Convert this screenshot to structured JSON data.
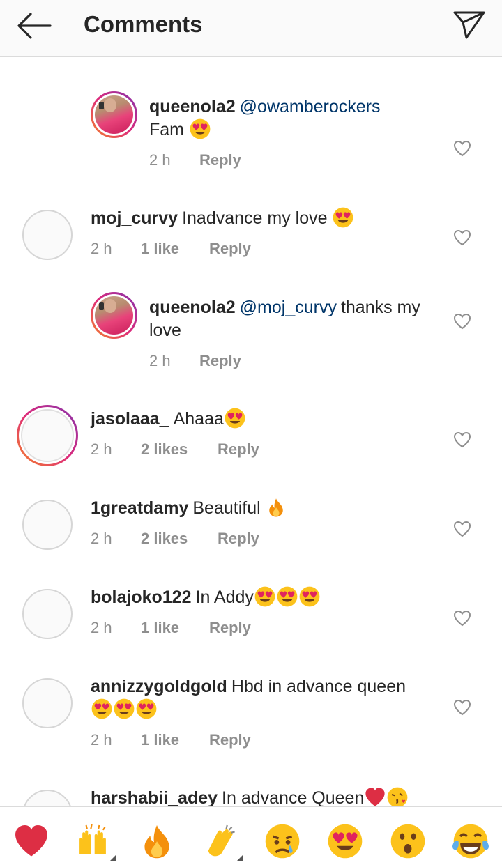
{
  "header": {
    "title": "Comments"
  },
  "comments": [
    {
      "username": "queenola2",
      "mention": "@owamberockers",
      "text": "Fam",
      "emojis": 1,
      "time": "2 h",
      "likes": "",
      "reply": "Reply",
      "is_reply": true
    },
    {
      "username": "moj_curvy",
      "mention": "",
      "text": "Inadvance my love",
      "emojis": 1,
      "time": "2 h",
      "likes": "1 like",
      "reply": "Reply",
      "is_reply": false
    },
    {
      "username": "queenola2",
      "mention": "@moj_curvy",
      "text": "thanks my love",
      "emojis": 0,
      "time": "2 h",
      "likes": "",
      "reply": "Reply",
      "is_reply": true
    },
    {
      "username": "jasolaaa_",
      "mention": "",
      "text": "Ahaaa",
      "emojis": 1,
      "time": "2 h",
      "likes": "2 likes",
      "reply": "Reply",
      "is_reply": false
    },
    {
      "username": "1greatdamy",
      "mention": "",
      "text": "Beautiful",
      "emojis": 0,
      "time": "2 h",
      "likes": "2 likes",
      "reply": "Reply",
      "is_reply": false
    },
    {
      "username": "bolajoko122",
      "mention": "",
      "text": "In Addy",
      "emojis": 3,
      "time": "2 h",
      "likes": "1 like",
      "reply": "Reply",
      "is_reply": false
    },
    {
      "username": "annizzygoldgold",
      "mention": "",
      "text": "Hbd in advance queen",
      "emojis": 3,
      "time": "2 h",
      "likes": "1 like",
      "reply": "Reply",
      "is_reply": false
    },
    {
      "username": "harshabii_adey",
      "mention": "",
      "text": "In advance Queen",
      "emojis": 0,
      "time": "",
      "likes": "",
      "reply": "",
      "is_reply": false
    }
  ],
  "reactions": [
    "red-heart",
    "raising-hands",
    "fire",
    "clapping-hands",
    "crying-face",
    "heart-eyes-face",
    "surprised-face",
    "tears-of-joy-face"
  ]
}
